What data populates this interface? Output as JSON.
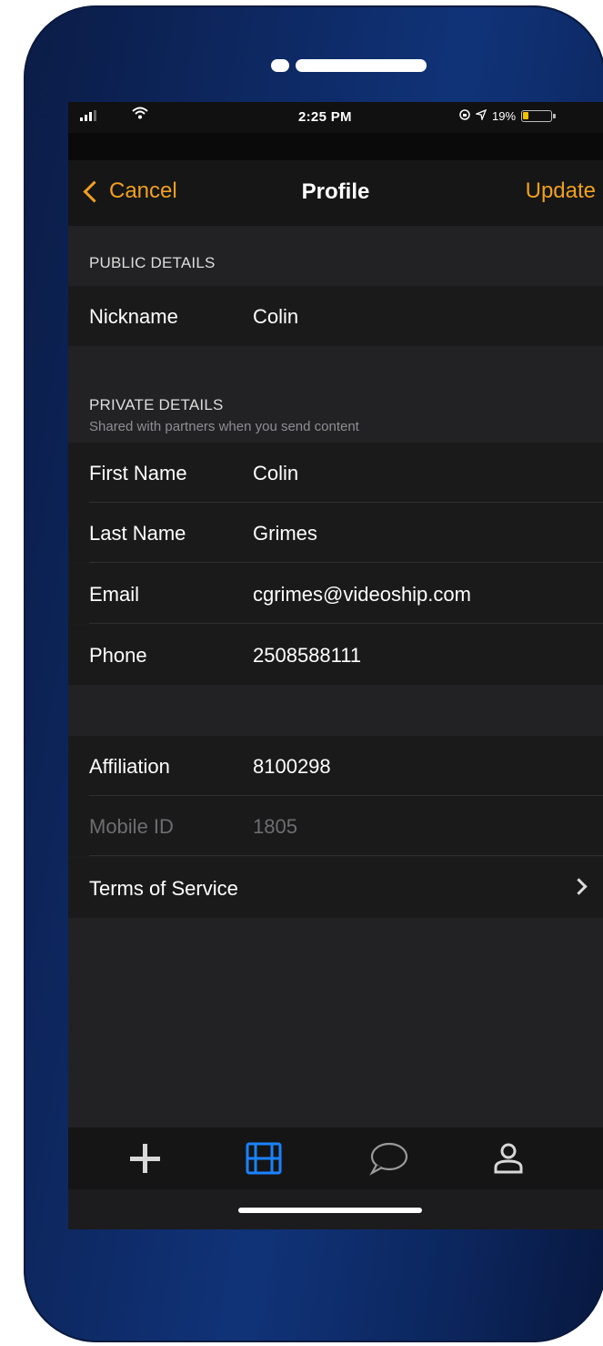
{
  "status_bar": {
    "time": "2:25 PM",
    "battery_percent": "19%",
    "battery_level": 0.19,
    "icons": [
      "signal-icon",
      "wifi-icon",
      "screen-lock-icon",
      "location-icon",
      "battery-icon"
    ]
  },
  "nav": {
    "cancel_label": "Cancel",
    "title": "Profile",
    "update_label": "Update"
  },
  "public_section": {
    "header": "PUBLIC DETAILS",
    "rows": [
      {
        "label": "Nickname",
        "value": "Colin"
      }
    ]
  },
  "private_section": {
    "header": "PRIVATE DETAILS",
    "subheader": "Shared with partners when you send content",
    "rows": [
      {
        "label": "First Name",
        "value": "Colin"
      },
      {
        "label": "Last Name",
        "value": "Grimes"
      },
      {
        "label": "Email",
        "value": "cgrimes@videoship.com"
      },
      {
        "label": "Phone",
        "value": "2508588111"
      }
    ]
  },
  "account_section": {
    "rows": [
      {
        "label": "Affiliation",
        "value": "8100298"
      },
      {
        "label": "Mobile ID",
        "value": "1805"
      }
    ],
    "terms_label": "Terms of Service"
  },
  "tab_bar": {
    "tabs": [
      {
        "icon": "plus-icon",
        "active": false
      },
      {
        "icon": "film-icon",
        "active": true
      },
      {
        "icon": "chat-bubble-icon",
        "active": false
      },
      {
        "icon": "person-icon",
        "active": false
      }
    ]
  },
  "colors": {
    "accent": "#f0a020",
    "active_tab": "#1a82ff",
    "phone_frame": "#0e2a66",
    "background": "#1c1c1e"
  }
}
